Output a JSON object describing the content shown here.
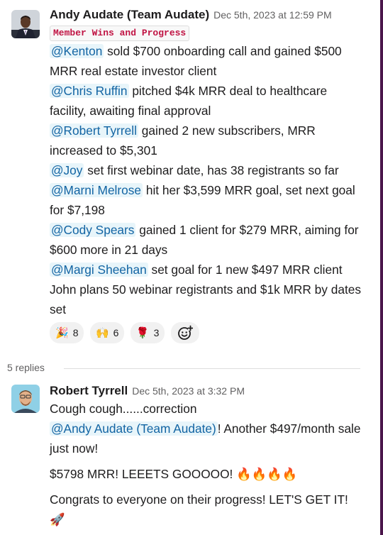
{
  "message": {
    "author": "Andy Audate (Team Audate)",
    "timestamp": "Dec 5th, 2023 at 12:59 PM",
    "code_tag": "Member Wins and Progress",
    "lines": [
      {
        "mention": "@Kenton",
        "text": " sold $700 onboarding call and gained $500 MRR real estate investor client"
      },
      {
        "mention": "@Chris Ruffin",
        "text": " pitched $4k MRR deal to healthcare facility, awaiting final approval"
      },
      {
        "mention": "@Robert Tyrrell",
        "text": " gained 2 new subscribers, MRR increased to $5,301"
      },
      {
        "mention": "@Joy",
        "text": " set first webinar date, has 38 registrants so far"
      },
      {
        "mention": "@Marni Melrose",
        "text": " hit her $3,599 MRR goal, set next goal for $7,198"
      },
      {
        "mention": "@Cody Spears",
        "text": " gained 1 client for $279 MRR, aiming for $600 more in 21 days"
      },
      {
        "mention": "@Margi Sheehan",
        "text": " set goal for 1 new $497 MRR client"
      }
    ],
    "trailing_text": "John plans 50 webinar registrants and $1k MRR by dates set",
    "reactions": [
      {
        "emoji": "🎉",
        "icon": "party-popper-icon",
        "count": "8"
      },
      {
        "emoji": "🙌",
        "icon": "raised-hands-icon",
        "count": "6"
      },
      {
        "emoji": "🌹",
        "icon": "rose-icon",
        "count": "3"
      }
    ]
  },
  "thread": {
    "replies_label": "5 replies"
  },
  "reply": {
    "author": "Robert Tyrrell",
    "timestamp": "Dec 5th, 2023 at 3:32 PM",
    "line1": "Cough cough......correction",
    "mention": "@Andy Audate (Team Audate)",
    "after_mention": "! Another $497/month sale just now!",
    "line3": "$5798 MRR! LEEETS GOOOOO! 🔥🔥🔥🔥",
    "line4": "Congrats to everyone on their progress! LET'S GET IT! 🚀"
  },
  "colors": {
    "mention_bg": "#e8f5fa",
    "mention_text": "#1264a3",
    "code_text": "#c01343",
    "sidebar_accent": "#4a154b"
  }
}
